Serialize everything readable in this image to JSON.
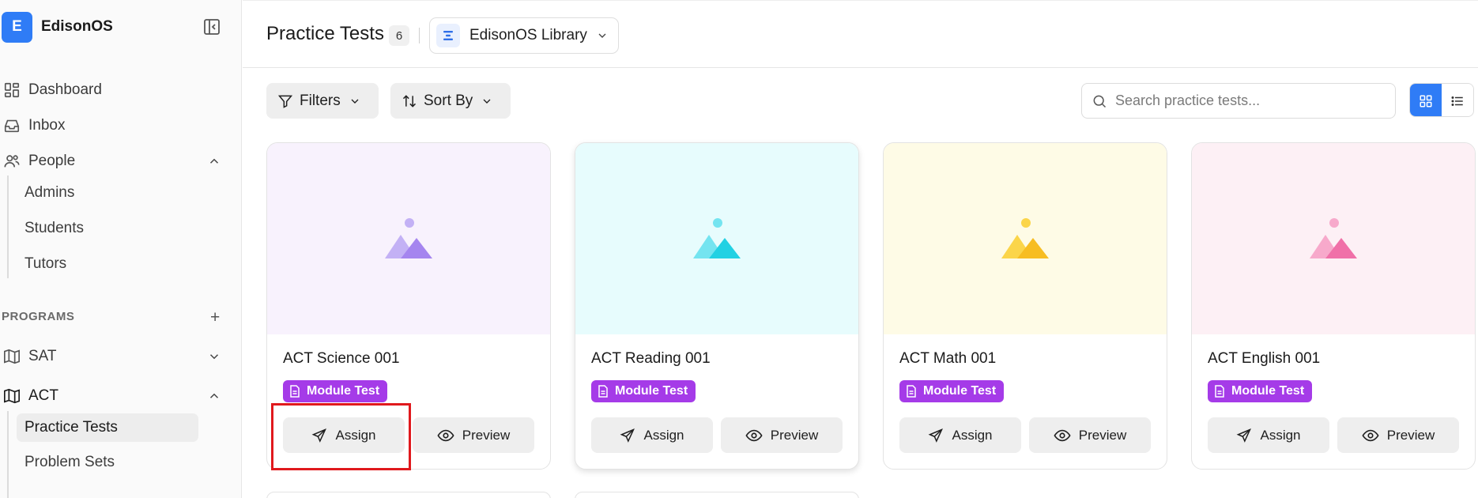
{
  "brand": {
    "logo_letter": "E",
    "name": "EdisonOS"
  },
  "nav": {
    "dashboard": "Dashboard",
    "inbox": "Inbox",
    "people": "People",
    "people_sub": [
      "Admins",
      "Students",
      "Tutors"
    ],
    "programs_label": "PROGRAMS",
    "programs_add": "+",
    "sat": "SAT",
    "act": "ACT",
    "act_sub": [
      "Practice Tests",
      "Problem Sets"
    ]
  },
  "header": {
    "title": "Practice Tests",
    "count": "6",
    "library": "EdisonOS Library"
  },
  "toolbar": {
    "filters": "Filters",
    "sort_by": "Sort By",
    "search_placeholder": "Search practice tests..."
  },
  "colors": {
    "accent": "#2f7cf6",
    "tag": "#a53be8",
    "highlight": "#e0191d"
  },
  "cards": [
    {
      "title": "ACT Science 001",
      "tag": "Module Test",
      "assign": "Assign",
      "preview": "Preview",
      "thumb_bg": "#f8f2fd",
      "icon_light": "#c3b1f5",
      "icon_dark": "#a585ef"
    },
    {
      "title": "ACT Reading 001",
      "tag": "Module Test",
      "assign": "Assign",
      "preview": "Preview",
      "thumb_bg": "#e7fcfd",
      "icon_light": "#74e4f0",
      "icon_dark": "#22d1e3"
    },
    {
      "title": "ACT Math 001",
      "tag": "Module Test",
      "assign": "Assign",
      "preview": "Preview",
      "thumb_bg": "#fefbe6",
      "icon_light": "#fbd54a",
      "icon_dark": "#f7bd22"
    },
    {
      "title": "ACT English 001",
      "tag": "Module Test",
      "assign": "Assign",
      "preview": "Preview",
      "thumb_bg": "#fdf0f5",
      "icon_light": "#f7a9cb",
      "icon_dark": "#f070a8"
    }
  ]
}
